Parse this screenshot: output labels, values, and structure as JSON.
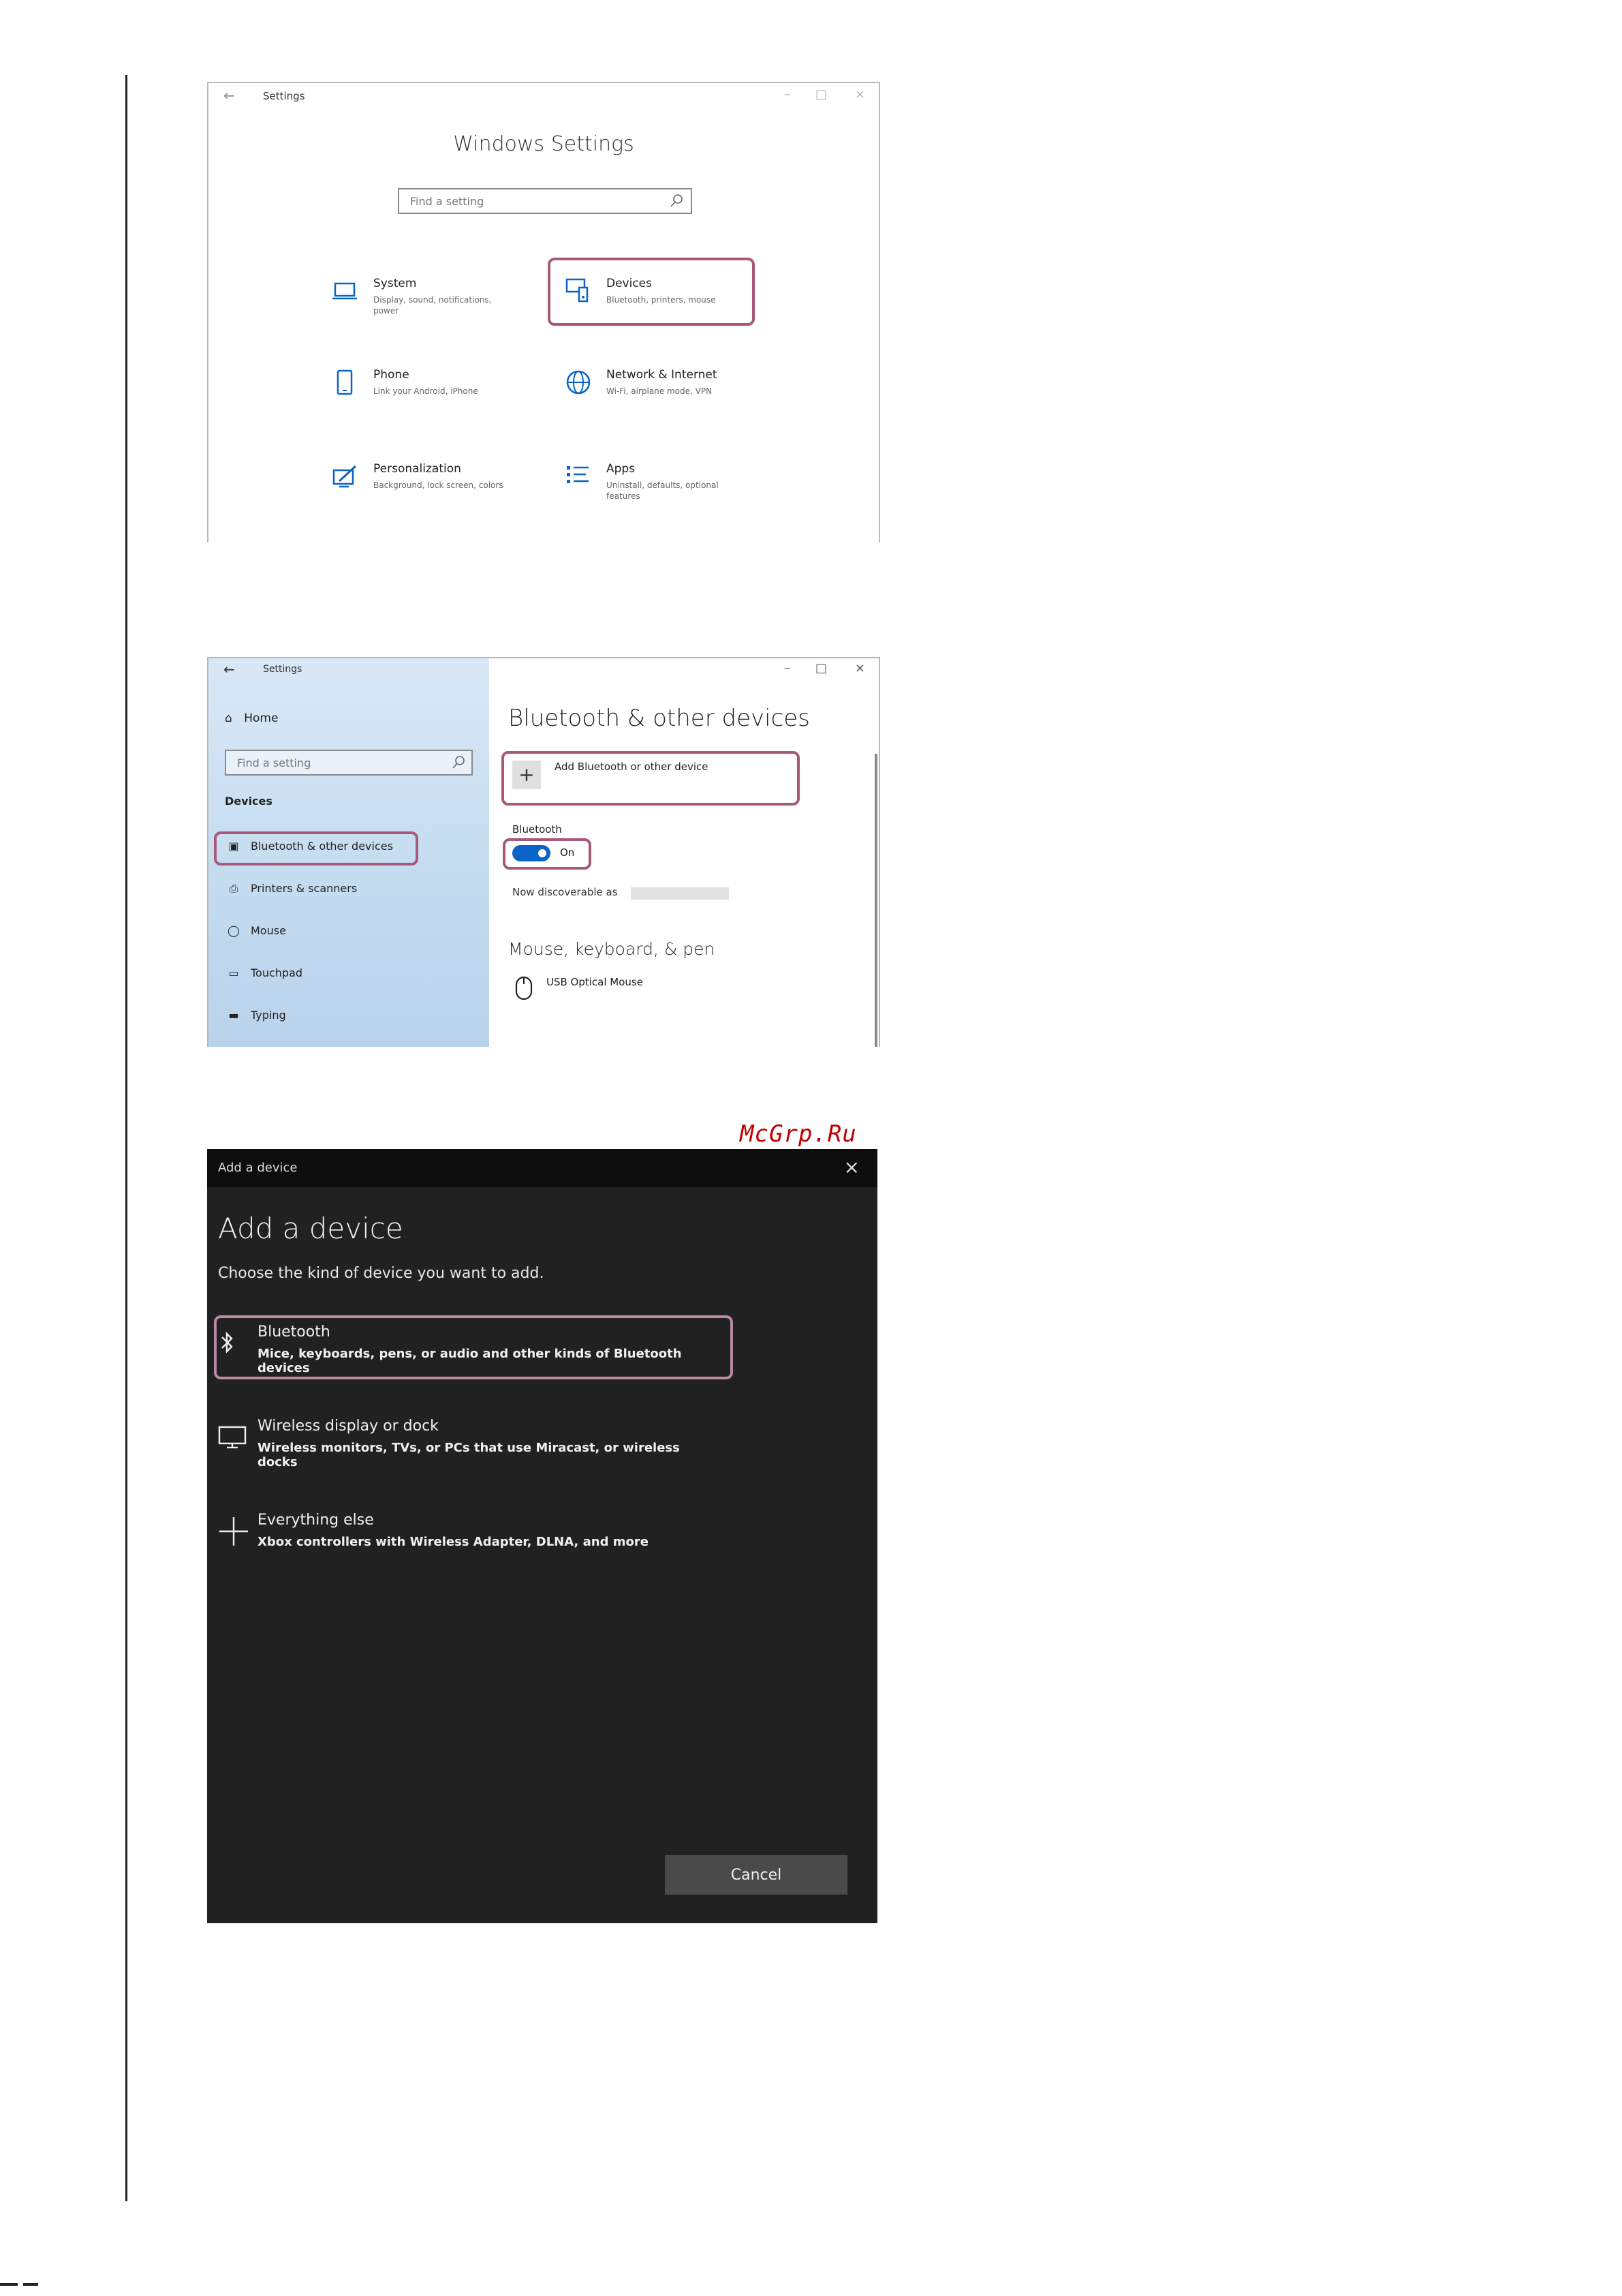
{
  "settings_home": {
    "window_title": "Settings",
    "heading": "Windows Settings",
    "search_placeholder": "Find a setting",
    "tiles": [
      {
        "title": "System",
        "desc": "Display, sound, notifications, power",
        "icon": "laptop-icon"
      },
      {
        "title": "Devices",
        "desc": "Bluetooth, printers, mouse",
        "icon": "devices-icon"
      },
      {
        "title": "Phone",
        "desc": "Link your Android, iPhone",
        "icon": "phone-icon"
      },
      {
        "title": "Network & Internet",
        "desc": "Wi-Fi, airplane mode, VPN",
        "icon": "globe-icon"
      },
      {
        "title": "Personalization",
        "desc": "Background, lock screen, colors",
        "icon": "paint-icon"
      },
      {
        "title": "Apps",
        "desc": "Uninstall, defaults, optional features",
        "icon": "apps-list-icon"
      }
    ]
  },
  "bluetooth_page": {
    "window_title": "Settings",
    "sidebar": {
      "home_label": "Home",
      "search_placeholder": "Find a setting",
      "group_label": "Devices",
      "items": [
        {
          "label": "Bluetooth & other devices"
        },
        {
          "label": "Printers & scanners"
        },
        {
          "label": "Mouse"
        },
        {
          "label": "Touchpad"
        },
        {
          "label": "Typing"
        }
      ]
    },
    "main": {
      "title": "Bluetooth & other devices",
      "add_label": "Add Bluetooth or other device",
      "bluetooth_label": "Bluetooth",
      "toggle_state": "On",
      "discoverable_label": "Now discoverable as",
      "section_title": "Mouse, keyboard, & pen",
      "device_name": "USB Optical Mouse"
    }
  },
  "watermark": "McGrp.Ru",
  "add_device_dialog": {
    "window_title": "Add a device",
    "heading": "Add a device",
    "subtitle": "Choose the kind of device you want to add.",
    "options": [
      {
        "title": "Bluetooth",
        "desc": "Mice, keyboards, pens, or audio and other kinds of Bluetooth devices",
        "icon": "bluetooth-icon"
      },
      {
        "title": "Wireless display or dock",
        "desc": "Wireless monitors, TVs, or PCs that use Miracast, or wireless docks",
        "icon": "monitor-icon"
      },
      {
        "title": "Everything else",
        "desc": "Xbox controllers with Wireless Adapter, DLNA, and more",
        "icon": "plus-icon"
      }
    ],
    "cancel_label": "Cancel"
  },
  "colors": {
    "highlight": "#a7597a",
    "toggle_on": "#0a63c7",
    "dialog_bg": "#212121",
    "watermark": "#c00000"
  }
}
